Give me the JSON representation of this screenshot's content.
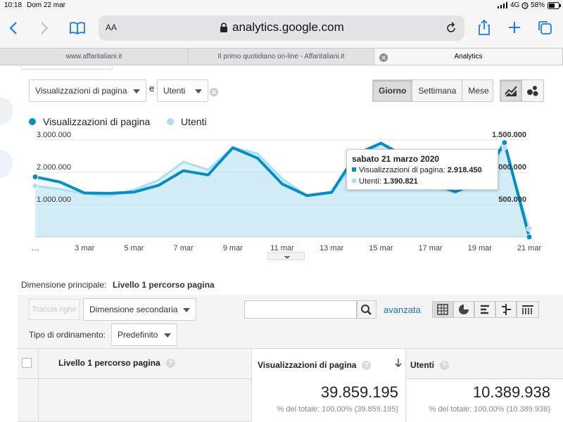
{
  "status": {
    "time": "10:18",
    "date": "Dom 22 mar",
    "network": "4G",
    "battery": "58%"
  },
  "browser": {
    "text_size_label": "AA",
    "url": "analytics.google.com",
    "tabs": [
      {
        "label": "www.affaritaliani.it"
      },
      {
        "label": "Il primo quotidiano on-line - Affaritaliani.it"
      },
      {
        "label": "Analytics"
      }
    ]
  },
  "controls": {
    "metric1": "Visualizzazioni di pagina",
    "conjunction": "e",
    "metric2": "Utenti",
    "period_buttons": [
      "Giorno",
      "Settimana",
      "Mese"
    ]
  },
  "chart_data": {
    "type": "line",
    "series": [
      {
        "name": "Visualizzazioni di pagina",
        "color": "#058dc7",
        "axis": "left",
        "values": [
          1860000,
          1700000,
          1360000,
          1350000,
          1390000,
          1600000,
          2050000,
          1920000,
          2760000,
          2440000,
          1640000,
          1280000,
          1380000,
          2560000,
          2900000,
          2480000,
          1680000,
          1400000,
          1680000,
          2918450,
          0
        ]
      },
      {
        "name": "Utenti",
        "color": "#aadff3",
        "axis": "right",
        "values": [
          790000,
          740000,
          670000,
          630000,
          730000,
          880000,
          1160000,
          1040000,
          1380000,
          1290000,
          900000,
          640000,
          680000,
          1180000,
          1440000,
          1200000,
          790000,
          680000,
          900000,
          1390821,
          130000
        ]
      }
    ],
    "x_labels": [
      "…",
      "3 mar",
      "5 mar",
      "7 mar",
      "9 mar",
      "11 mar",
      "13 mar",
      "15 mar",
      "17 mar",
      "19 mar",
      "21 mar"
    ],
    "y_left_labels": [
      "3.000.000",
      "2.000.000",
      "1.000.000"
    ],
    "y_left_range": [
      0,
      3000000
    ],
    "y_right_labels": [
      "1.500.000",
      "1.000.000",
      "500.000"
    ],
    "y_right_range": [
      0,
      1500000
    ],
    "tooltip": {
      "title": "sabato 21 marzo 2020",
      "line1_label": "Visualizzazioni di pagina:",
      "line1_value": "2.918.450",
      "line2_label": "Utenti:",
      "line2_value": "1.390.821"
    }
  },
  "table_controls": {
    "primary_dim_label": "Dimensione principale:",
    "primary_dim_value": "Livello 1 percorso pagina",
    "plot_rows_button": "Traccia righe",
    "secondary_dim": "Dimensione secondaria",
    "advanced_link": "avanzata",
    "sort_label": "Tipo di ordinamento:",
    "sort_value": "Predefinito"
  },
  "table": {
    "columns": [
      "Livello 1 percorso pagina",
      "Visualizzazioni di pagina",
      "Utenti"
    ],
    "totals": [
      {
        "value": "39.859.195",
        "sub": "% del totale: 100,00% (39.859.195)"
      },
      {
        "value": "10.389.938",
        "sub": "% del totale: 100,00% (10.389.938)"
      }
    ]
  },
  "colors": {
    "primary": "#058dc7",
    "secondary": "#aadff3",
    "link": "#1a73b8"
  }
}
